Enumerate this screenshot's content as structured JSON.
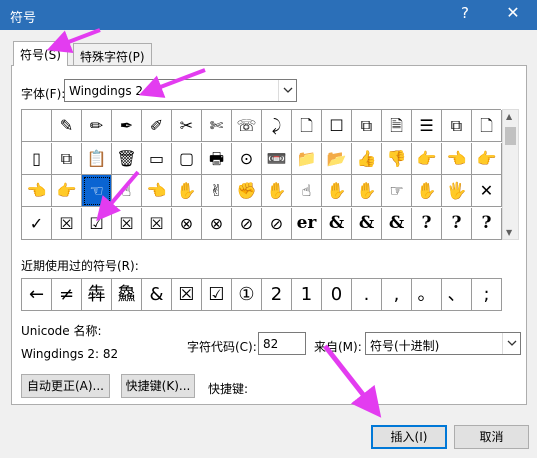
{
  "window": {
    "title": "符号",
    "help_glyph": "?",
    "close_glyph": "✕"
  },
  "tabs": [
    {
      "label": "符号(S)"
    },
    {
      "label": "特殊字符(P)"
    }
  ],
  "font": {
    "label": "字体(F):",
    "value": "Wingdings 2"
  },
  "symbol_grid": {
    "rows": [
      [
        "",
        "✎",
        "✏",
        "✒",
        "✐",
        "✂",
        "✄",
        "☏",
        "⤸",
        "🗋",
        "☐",
        "⧉",
        "🗎",
        "☰",
        "⧉",
        "🗋"
      ],
      [
        "▯",
        "⧉",
        "📋",
        "🗑",
        "▭",
        "▢",
        "🖶",
        "⊙",
        "📼",
        "📁",
        "📂",
        "👍",
        "👎",
        "👉",
        "👈",
        "👉"
      ],
      [
        "👈",
        "👉",
        "☜",
        "☝",
        "👈",
        "✋",
        "✌",
        "✊",
        "✋",
        "☝",
        "✋",
        "✋",
        "☞",
        "✋",
        "🖐",
        "✕"
      ],
      [
        "✓",
        "☒",
        "☑",
        "☒",
        "☒",
        "⊗",
        "⊗",
        "⊘",
        "⊘",
        "er",
        "&",
        "&",
        "&",
        "?",
        "?",
        "?"
      ]
    ],
    "selected_index": 34
  },
  "recent": {
    "label": "近期使用过的符号(R):",
    "items": [
      "←",
      "≠",
      "犇",
      "鱻",
      "&",
      "☒",
      "☑",
      "①",
      "2",
      "1",
      "0",
      ".",
      ",",
      "。",
      "、",
      ";"
    ]
  },
  "unicode_name": {
    "label": "Unicode 名称:",
    "value": "Wingdings 2: 82"
  },
  "char_code": {
    "label": "字符代码(C):",
    "value": "82"
  },
  "from": {
    "label": "来自(M):",
    "value": "符号(十进制)"
  },
  "buttons": {
    "autocorrect": "自动更正(A)...",
    "shortcut_key": "快捷键(K)...",
    "shortcut_label": "快捷键:",
    "insert": "插入(I)",
    "cancel": "取消"
  },
  "colors": {
    "titlebar": "#2b6fb8",
    "selected": "#0a64d2",
    "annotation": "#e33cf0"
  }
}
